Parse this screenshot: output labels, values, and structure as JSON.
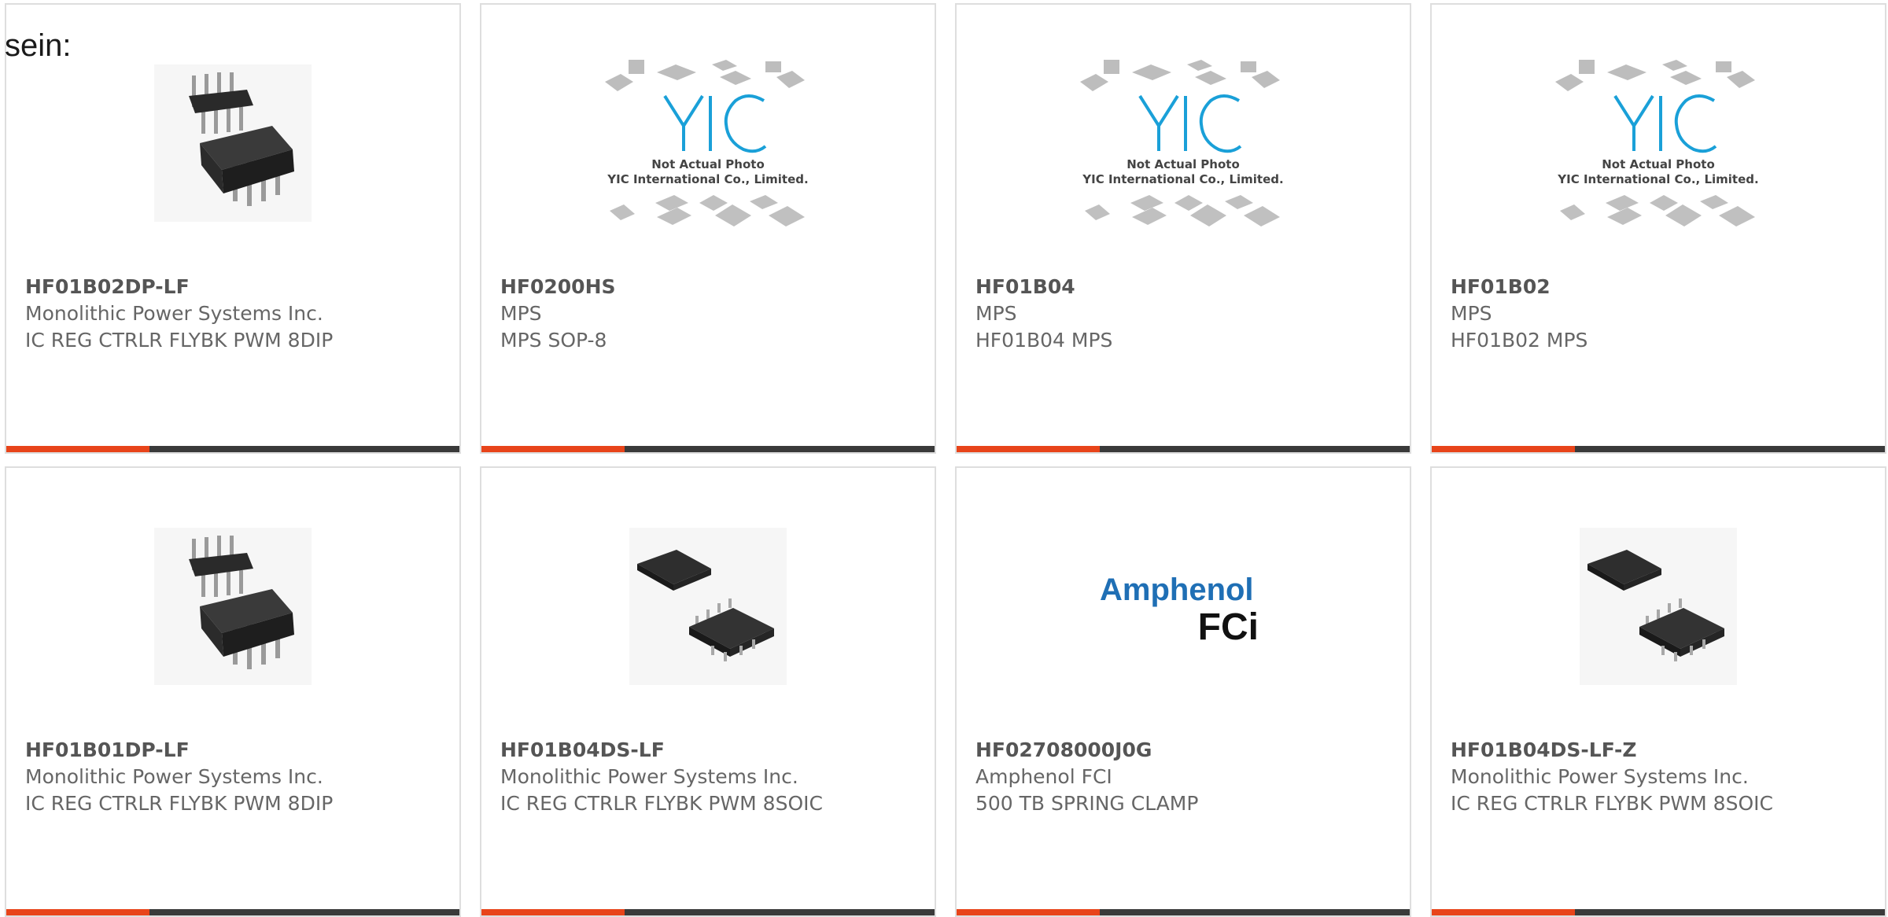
{
  "page": {
    "lead_text": "sein:"
  },
  "colors": {
    "accent": "#e8441a",
    "bar": "#3a3a3a",
    "border": "#dedede",
    "yic_blue": "#1aa0d8",
    "amphenol_blue": "#1f6fb5"
  },
  "products": [
    {
      "part": "HF01B02DP-LF",
      "maker": "Monolithic Power Systems Inc.",
      "desc": "IC REG CTRLR FLYBK PWM 8DIP",
      "image": "dip8-chip-icon"
    },
    {
      "part": "HF0200HS",
      "maker": "MPS",
      "desc": "MPS SOP-8",
      "image": "yic-placeholder",
      "photo_caption_1": "Not Actual Photo",
      "photo_caption_2": "YIC International Co., Limited."
    },
    {
      "part": "HF01B04",
      "maker": "MPS",
      "desc": "HF01B04 MPS",
      "image": "yic-placeholder",
      "photo_caption_1": "Not Actual Photo",
      "photo_caption_2": "YIC International Co., Limited."
    },
    {
      "part": "HF01B02",
      "maker": "MPS",
      "desc": "HF01B02 MPS",
      "image": "yic-placeholder",
      "photo_caption_1": "Not Actual Photo",
      "photo_caption_2": "YIC International Co., Limited."
    },
    {
      "part": "HF01B01DP-LF",
      "maker": "Monolithic Power Systems Inc.",
      "desc": "IC REG CTRLR FLYBK PWM 8DIP",
      "image": "dip8-chip-icon"
    },
    {
      "part": "HF01B04DS-LF",
      "maker": "Monolithic Power Systems Inc.",
      "desc": "IC REG CTRLR FLYBK PWM 8SOIC",
      "image": "soic8-chip-icon"
    },
    {
      "part": "HF02708000J0G",
      "maker": "Amphenol FCI",
      "desc": "500 TB SPRING CLAMP",
      "image": "amphenol-logo",
      "logo_line_1": "Amphenol",
      "logo_line_2": "FCi"
    },
    {
      "part": "HF01B04DS-LF-Z",
      "maker": "Monolithic Power Systems Inc.",
      "desc": "IC REG CTRLR FLYBK PWM 8SOIC",
      "image": "soic8-chip-icon"
    }
  ]
}
